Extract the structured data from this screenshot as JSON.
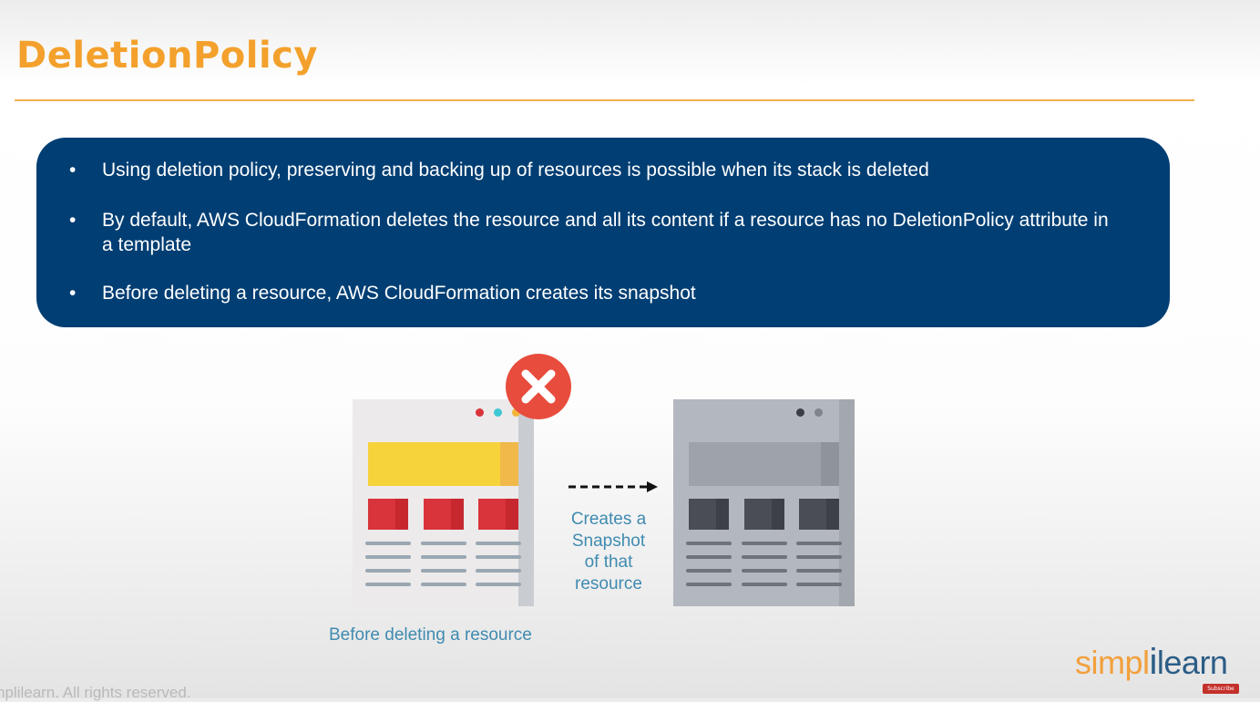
{
  "slide": {
    "title": "DeletionPolicy",
    "bullets": [
      "Using deletion policy, preserving and backing up of resources is possible when its stack is deleted",
      "By default, AWS CloudFormation deletes the resource and all its content if a resource has no DeletionPolicy attribute in a template",
      "Before deleting a resource, AWS CloudFormation creates its snapshot"
    ],
    "bullet_glyph": "•"
  },
  "illustration": {
    "arrow_caption_lines": [
      "Creates a",
      "Snapshot",
      "of that",
      "resource"
    ],
    "before_caption": "Before deleting a resource",
    "icons": {
      "delete": "x-circle-icon",
      "arrow": "dashed-arrow-right-icon"
    },
    "colors": {
      "accent_red": "#e84c3d",
      "highlight_yellow": "#f7d33b",
      "block_red": "#d9333b",
      "block_dark": "#4a4d54"
    }
  },
  "footer": {
    "copyright": "nplilearn. All rights reserved."
  },
  "brand": {
    "logo_left": "simpl",
    "logo_sep": "i",
    "logo_right": "learn",
    "youtube_badge": "Subscribe"
  },
  "theme": {
    "title_color": "#f3a12c",
    "panel_color": "#003e73"
  }
}
